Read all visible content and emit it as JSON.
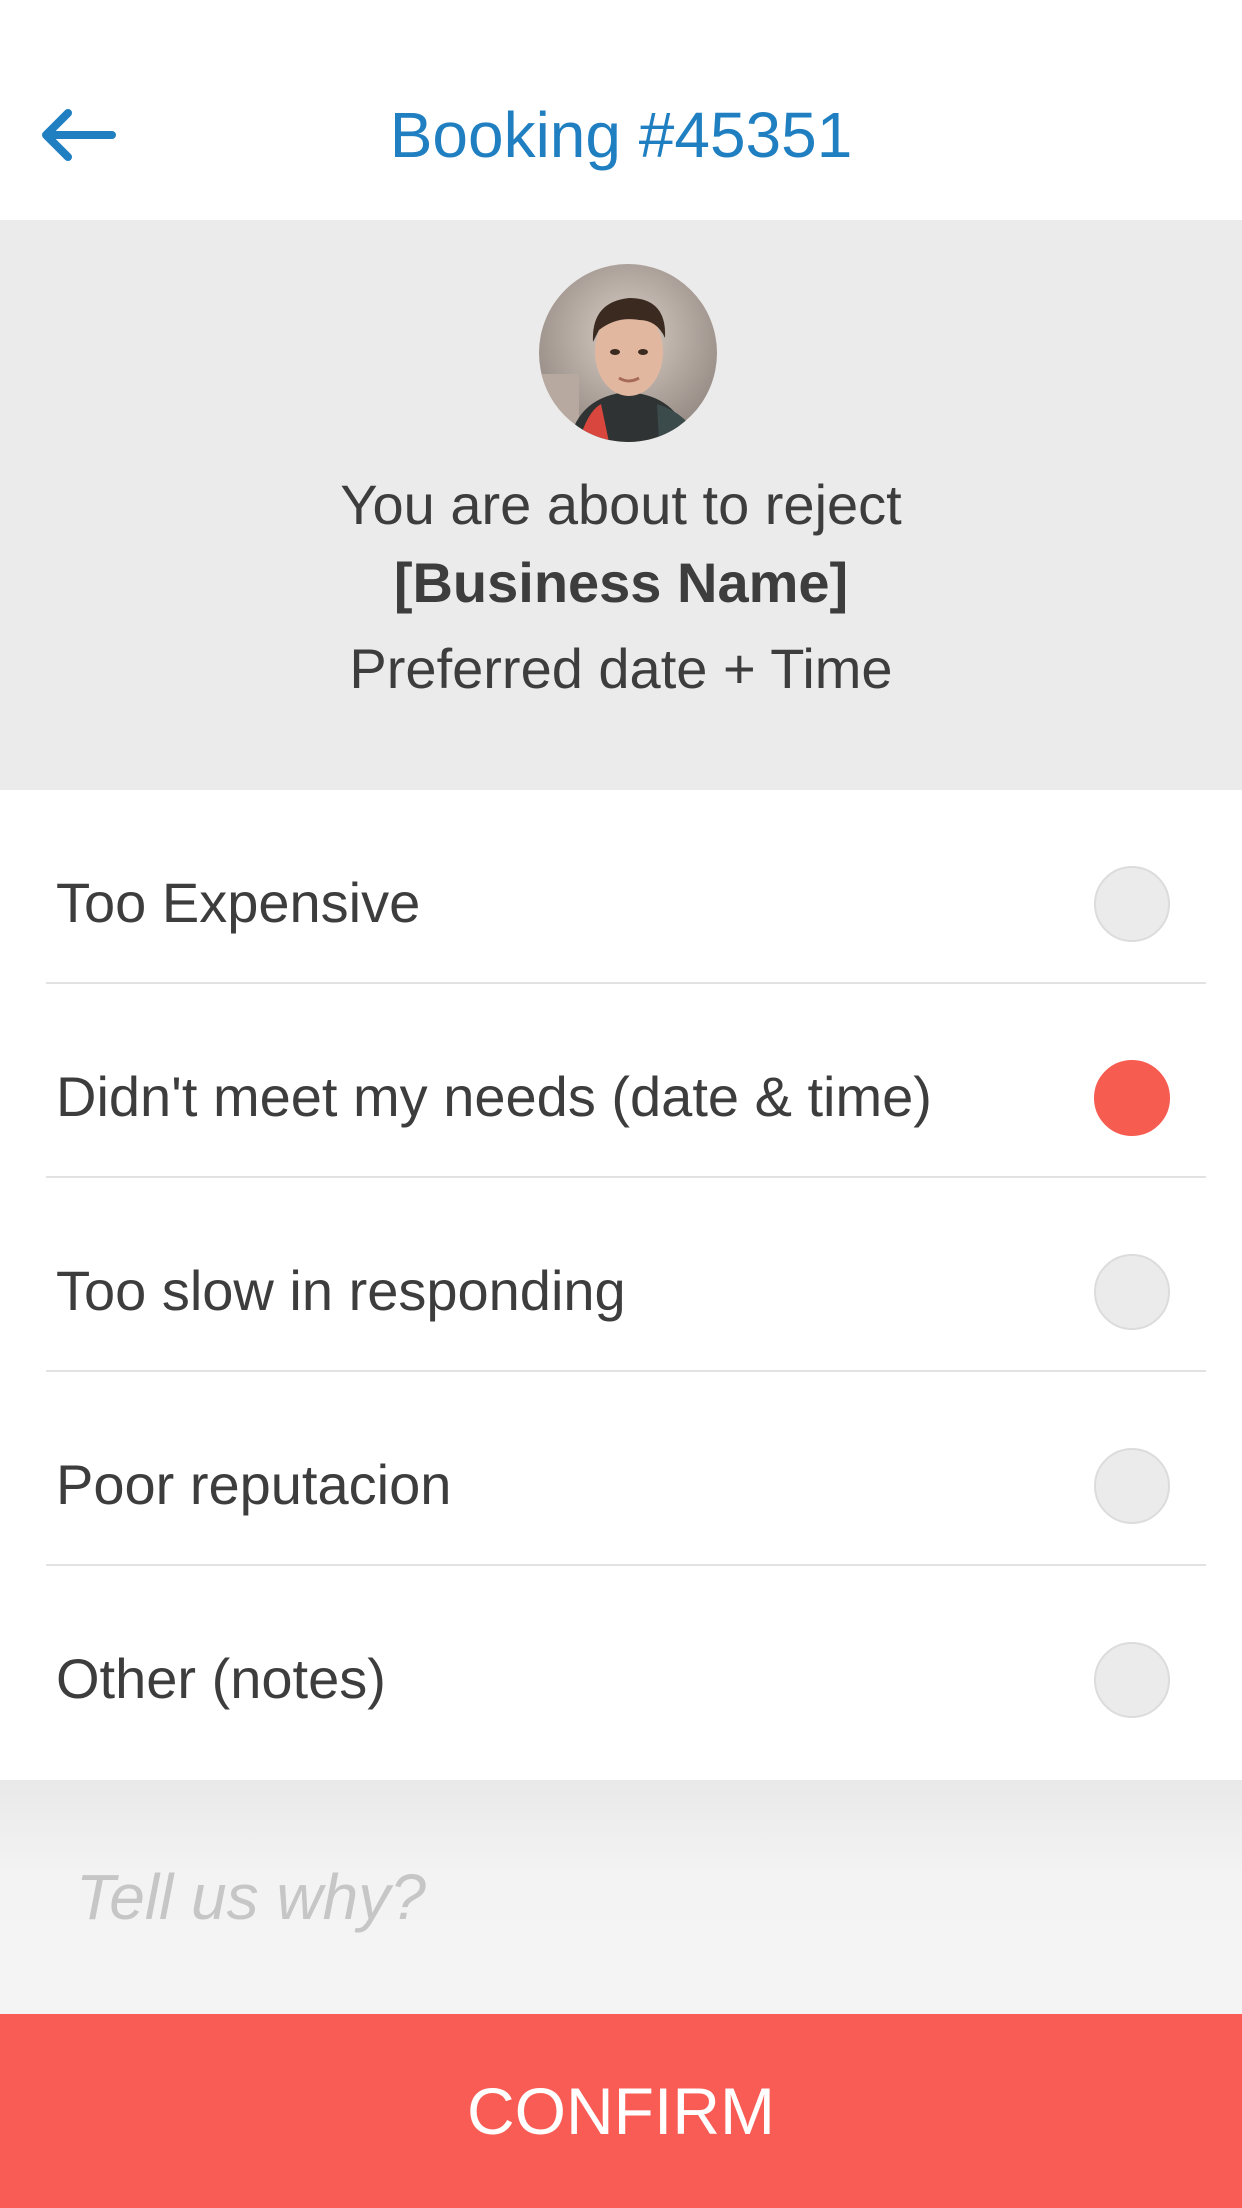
{
  "header": {
    "title": "Booking #45351",
    "back_icon": "arrow-left-icon",
    "accent_color": "#1f7fc1"
  },
  "hero": {
    "line1": "You are about to reject",
    "business_name": "[Business Name]",
    "line3": "Preferred date + Time"
  },
  "options": [
    {
      "label": "Too Expensive",
      "selected": false
    },
    {
      "label": "Didn't meet my needs (date & time)",
      "selected": true
    },
    {
      "label": "Too slow in responding",
      "selected": false
    },
    {
      "label": "Poor reputacion",
      "selected": false
    },
    {
      "label": "Other (notes)",
      "selected": false
    }
  ],
  "notes": {
    "placeholder": "Tell us why?",
    "value": ""
  },
  "confirm": {
    "label": "CONFIRM",
    "color": "#f85c54"
  }
}
